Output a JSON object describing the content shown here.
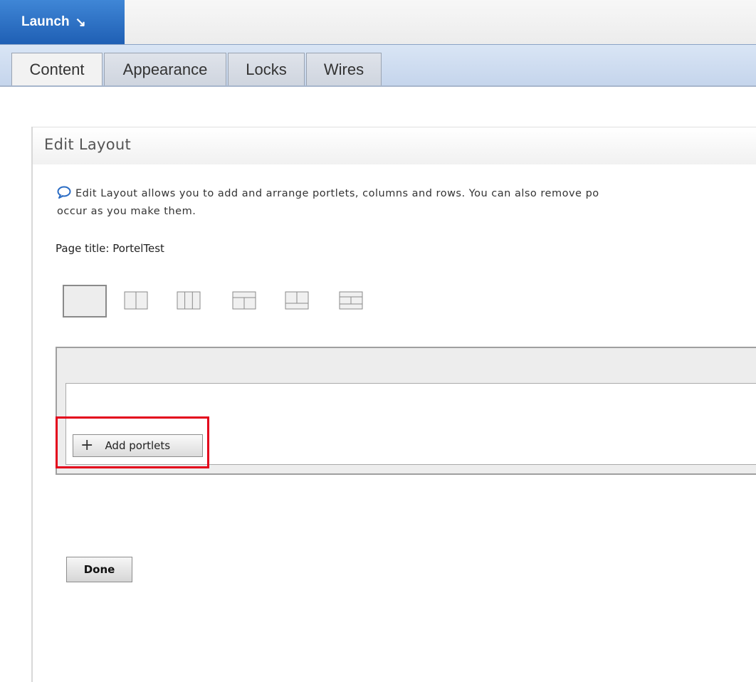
{
  "launch": {
    "label": "Launch",
    "arrow": "↘"
  },
  "tabs": [
    {
      "label": "Content",
      "active": true
    },
    {
      "label": "Appearance",
      "active": false
    },
    {
      "label": "Locks",
      "active": false
    },
    {
      "label": "Wires",
      "active": false
    }
  ],
  "panel": {
    "title": "Edit Layout",
    "info_line1": "Edit Layout allows you to add and arrange portlets, columns and rows. You can also remove po",
    "info_line2": "occur as you make them.",
    "page_title": "Page title: PortelTest"
  },
  "layout_options": [
    "layout-1-column-icon",
    "layout-2-columns-icon",
    "layout-3-columns-icon",
    "layout-row-over-2-columns-icon",
    "layout-2-columns-over-row-icon",
    "layout-row-2-columns-row-icon"
  ],
  "add_portlets": {
    "label": "Add portlets",
    "icon": "plus-icon"
  },
  "done": {
    "label": "Done"
  },
  "colors": {
    "launch_blue": "#1f5fb4",
    "tab_bar": "#c5d5ec",
    "highlight_red": "#e3001b"
  }
}
